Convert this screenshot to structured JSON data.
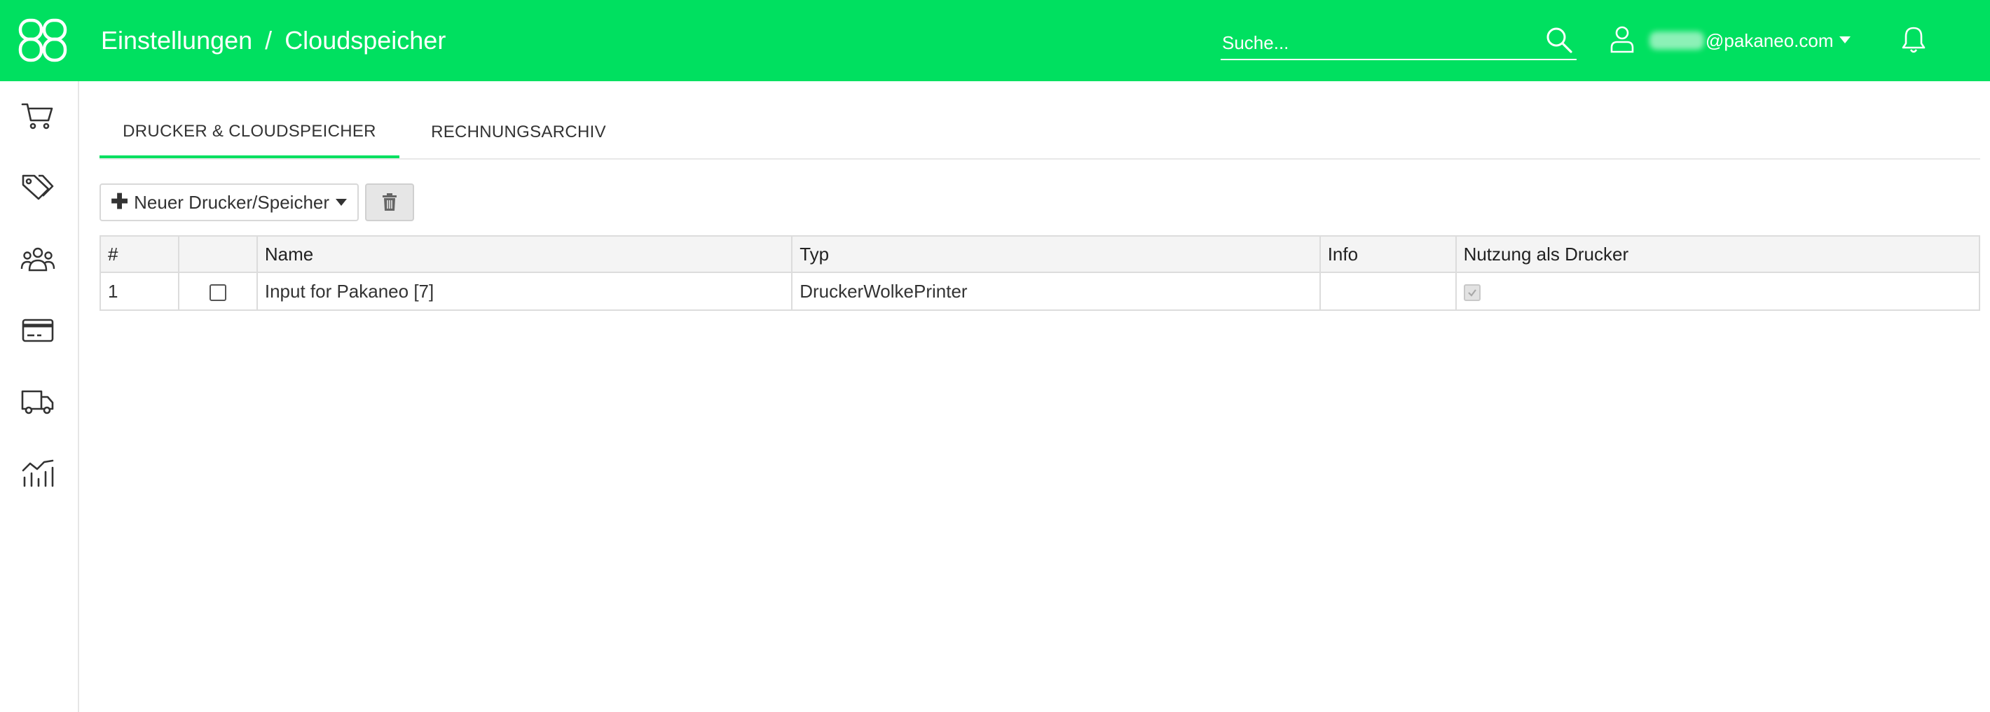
{
  "colors": {
    "brand": "#00e060",
    "sidebar_border": "#e6e6e6",
    "header_bg": "#f4f4f4"
  },
  "header": {
    "breadcrumb": [
      "Einstellungen",
      "Cloudspeicher"
    ],
    "breadcrumb_separator": "/",
    "search_placeholder": "Suche...",
    "user_email_suffix": "@pakaneo.com",
    "icons": {
      "logo": "pakaneo-logo",
      "search": "search-icon",
      "user": "user-icon",
      "caret": "caret-down-icon",
      "notifications": "bell-icon"
    }
  },
  "sidebar": {
    "items": [
      {
        "name": "orders",
        "icon": "cart-icon"
      },
      {
        "name": "products",
        "icon": "tags-icon"
      },
      {
        "name": "customers",
        "icon": "users-icon"
      },
      {
        "name": "payments",
        "icon": "credit-card-icon"
      },
      {
        "name": "shipping",
        "icon": "truck-icon"
      },
      {
        "name": "statistics",
        "icon": "chart-icon"
      }
    ]
  },
  "tabs": [
    {
      "label": "DRUCKER & CLOUDSPEICHER",
      "active": true
    },
    {
      "label": "RECHNUNGSARCHIV",
      "active": false
    }
  ],
  "toolbar": {
    "new_label": "Neuer Drucker/Speicher",
    "delete_icon": "trash-icon"
  },
  "table": {
    "columns": [
      "#",
      "",
      "Name",
      "Typ",
      "Info",
      "Nutzung als Drucker"
    ],
    "rows": [
      {
        "num": "1",
        "selected": false,
        "name": "Input for Pakaneo [7]",
        "typ": "DruckerWolkePrinter",
        "info": "",
        "printer_use": true
      }
    ]
  }
}
